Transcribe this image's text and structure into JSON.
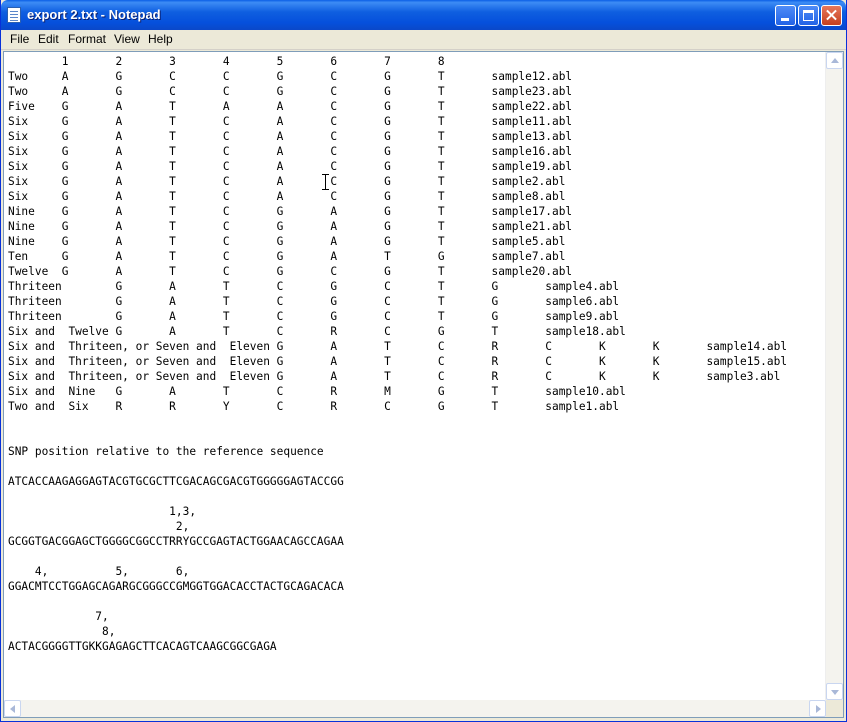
{
  "window": {
    "title": "export 2.txt - Notepad"
  },
  "menu": {
    "items": [
      "File",
      "Edit",
      "Format",
      "View",
      "Help"
    ]
  },
  "document": {
    "lines": [
      "        1       2       3       4       5       6       7       8",
      "Two     A       G       C       C       G       C       G       T       sample12.abl",
      "Two     A       G       C       C       G       C       G       T       sample23.abl",
      "Five    G       A       T       A       A       C       G       T       sample22.abl",
      "Six     G       A       T       C       A       C       G       T       sample11.abl",
      "Six     G       A       T       C       A       C       G       T       sample13.abl",
      "Six     G       A       T       C       A       C       G       T       sample16.abl",
      "Six     G       A       T       C       A       C       G       T       sample19.abl",
      "Six     G       A       T       C       A       C       G       T       sample2.abl",
      "Six     G       A       T       C       A       C       G       T       sample8.abl",
      "Nine    G       A       T       C       G       A       G       T       sample17.abl",
      "Nine    G       A       T       C       G       A       G       T       sample21.abl",
      "Nine    G       A       T       C       G       A       G       T       sample5.abl",
      "Ten     G       A       T       C       G       A       T       G       sample7.abl",
      "Twelve  G       A       T       C       G       C       G       T       sample20.abl",
      "Thriteen        G       A       T       C       G       C       T       G       sample4.abl",
      "Thriteen        G       A       T       C       G       C       T       G       sample6.abl",
      "Thriteen        G       A       T       C       G       C       T       G       sample9.abl",
      "Six and  Twelve G       A       T       C       R       C       G       T       sample18.abl",
      "Six and  Thriteen, or Seven and  Eleven G       A       T       C       R       C       K       K       sample14.abl",
      "Six and  Thriteen, or Seven and  Eleven G       A       T       C       R       C       K       K       sample15.abl",
      "Six and  Thriteen, or Seven and  Eleven G       A       T       C       R       C       K       K       sample3.abl",
      "Six and  Nine   G       A       T       C       R       M       G       T       sample10.abl",
      "Two and  Six    R       R       Y       C       R       C       G       T       sample1.abl",
      "",
      "",
      "SNP position relative to the reference sequence",
      "",
      "ATCACCAAGAGGAGTACGTGCGCTTCGACAGCGACGTGGGGGAGTACCGG",
      "",
      "                        1,3,",
      "                         2,",
      "GCGGTGACGGAGCTGGGGCGGCCTRRYGCCGAGTACTGGAACAGCCAGAA",
      "",
      "    4,          5,       6,",
      "GGACMTCCTGGAGCAGARGCGGGCCGMGGTGGACACCTACTGCAGACACA",
      "",
      "             7,",
      "              8,",
      "ACTACGGGGTTGKKGAGAGCTTCACAGTCAAGCGGCGAGA"
    ]
  },
  "icons": {
    "app": "notepad-icon",
    "minimize": "minimize-icon",
    "maximize": "maximize-icon",
    "close": "close-icon"
  }
}
